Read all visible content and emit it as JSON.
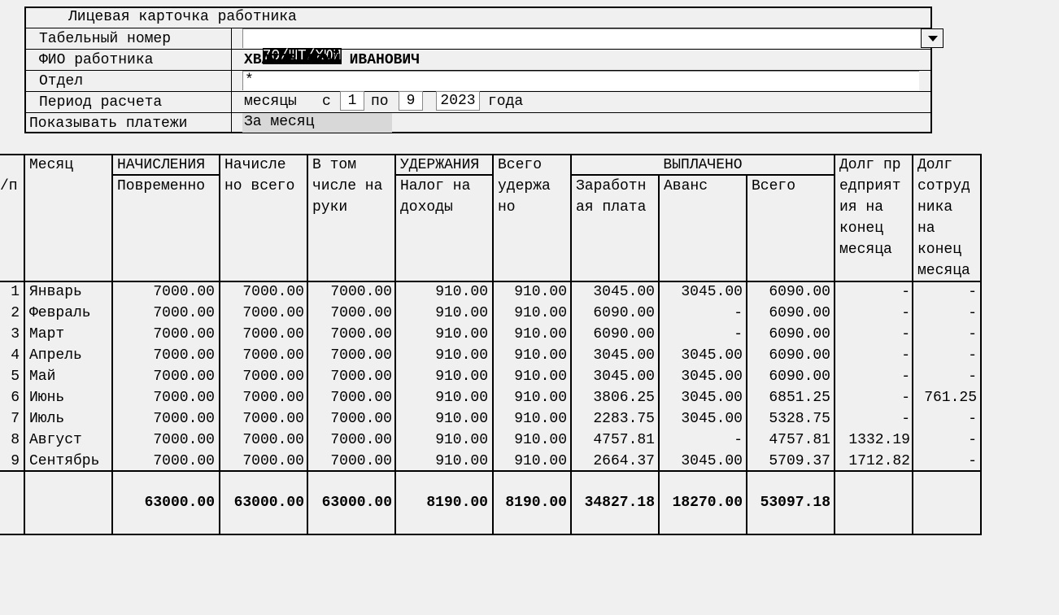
{
  "form": {
    "title": "Лицевая карточка работника",
    "tab_label": "Табельный номер",
    "tab_value": "70/ШТ/ХЮИ",
    "fio_label": "ФИО работника",
    "fio_value": "ХВАТОВ ЮРИЙ ИВАНОВИЧ",
    "dept_label": "Отдел",
    "dept_value": "*",
    "period_label": "Период расчета",
    "period_months": "месяцы",
    "period_from_word": "с",
    "period_from": "1",
    "period_to_word": "по",
    "period_to": "9",
    "period_year": "2023",
    "period_year_word": "года",
    "show_label": "Показывать платежи",
    "show_value": "За месяц"
  },
  "table": {
    "headers": {
      "num": "/п",
      "month": "Месяц",
      "accr_group": "НАЧИСЛЕНИЯ",
      "accr_time": "Повременно",
      "accr_total1": "Начисле",
      "accr_total2": "но всего",
      "hand1": "В том",
      "hand2": "числе на",
      "hand3": "руки",
      "ded_group": "УДЕРЖАНИЯ",
      "tax1": "Налог на",
      "tax2": "доходы",
      "ded_total1": "Всего",
      "ded_total2": "удержа",
      "ded_total3": "но",
      "paid_group": "ВЫПЛАЧЕНО",
      "salary1": "Заработн",
      "salary2": "ая плата",
      "advance": "Аванс",
      "paid_total": "Всего",
      "debt_ent1": "Долг пр",
      "debt_ent2": "едприят",
      "debt_ent3": "ия на",
      "debt_ent4": "конец",
      "debt_ent5": "месяца",
      "debt_emp1": "Долг",
      "debt_emp2": "сотруд",
      "debt_emp3": "ника",
      "debt_emp4": "на",
      "debt_emp5": "конец",
      "debt_emp6": "месяца"
    },
    "rows": [
      [
        "1",
        "Январь",
        "7000.00",
        "7000.00",
        "7000.00",
        "910.00",
        "910.00",
        "3045.00",
        "3045.00",
        "6090.00",
        "-",
        "-"
      ],
      [
        "2",
        "Февраль",
        "7000.00",
        "7000.00",
        "7000.00",
        "910.00",
        "910.00",
        "6090.00",
        "-",
        "6090.00",
        "-",
        "-"
      ],
      [
        "3",
        "Март",
        "7000.00",
        "7000.00",
        "7000.00",
        "910.00",
        "910.00",
        "6090.00",
        "-",
        "6090.00",
        "-",
        "-"
      ],
      [
        "4",
        "Апрель",
        "7000.00",
        "7000.00",
        "7000.00",
        "910.00",
        "910.00",
        "3045.00",
        "3045.00",
        "6090.00",
        "-",
        "-"
      ],
      [
        "5",
        "Май",
        "7000.00",
        "7000.00",
        "7000.00",
        "910.00",
        "910.00",
        "3045.00",
        "3045.00",
        "6090.00",
        "-",
        "-"
      ],
      [
        "6",
        "Июнь",
        "7000.00",
        "7000.00",
        "7000.00",
        "910.00",
        "910.00",
        "3806.25",
        "3045.00",
        "6851.25",
        "-",
        "761.25"
      ],
      [
        "7",
        "Июль",
        "7000.00",
        "7000.00",
        "7000.00",
        "910.00",
        "910.00",
        "2283.75",
        "3045.00",
        "5328.75",
        "-",
        "-"
      ],
      [
        "8",
        "Август",
        "7000.00",
        "7000.00",
        "7000.00",
        "910.00",
        "910.00",
        "4757.81",
        "-",
        "4757.81",
        "1332.19",
        "-"
      ],
      [
        "9",
        "Сентябрь",
        "7000.00",
        "7000.00",
        "7000.00",
        "910.00",
        "910.00",
        "2664.37",
        "3045.00",
        "5709.37",
        "1712.82",
        "-"
      ]
    ],
    "totals": [
      "",
      "",
      "63000.00",
      "63000.00",
      "63000.00",
      "8190.00",
      "8190.00",
      "34827.18",
      "18270.00",
      "53097.18",
      "",
      ""
    ]
  }
}
